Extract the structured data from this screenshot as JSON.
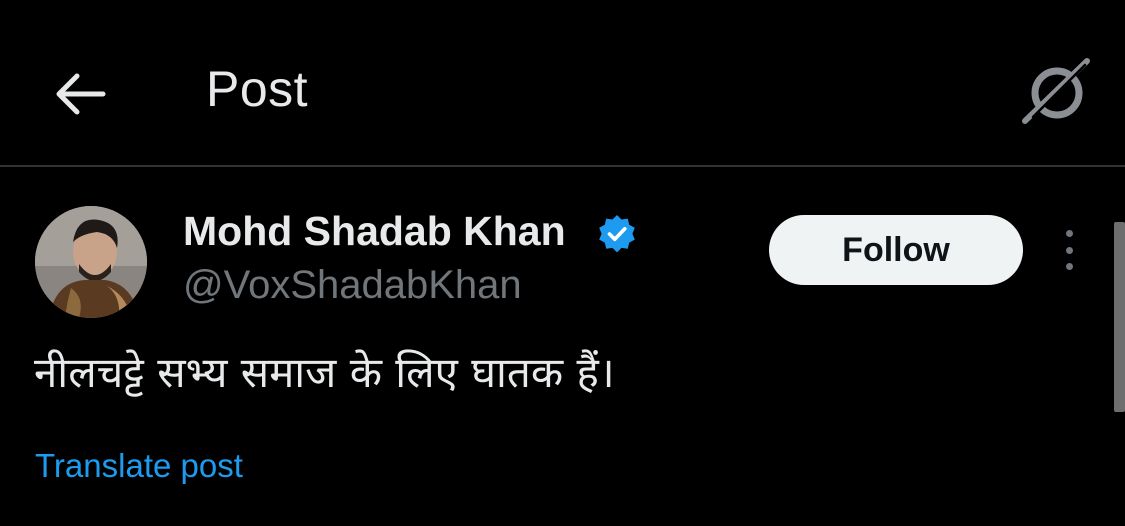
{
  "header": {
    "title": "Post",
    "back_icon": "arrow-left-icon",
    "grok_icon": "grok-icon"
  },
  "post": {
    "author": {
      "name": "Mohd Shadab Khan",
      "handle": "@VoxShadabKhan",
      "verified": true,
      "verified_color": "#1d9bf0"
    },
    "follow_label": "Follow",
    "text": "नीलचट्टे सभ्य समाज के लिए घातक हैं।",
    "translate_label": "Translate post"
  },
  "colors": {
    "background": "#000000",
    "text_primary": "#e7e9ea",
    "text_secondary": "#71767b",
    "link": "#1d9bf0",
    "divider": "#2f3336",
    "button_bg": "#eff3f4"
  }
}
